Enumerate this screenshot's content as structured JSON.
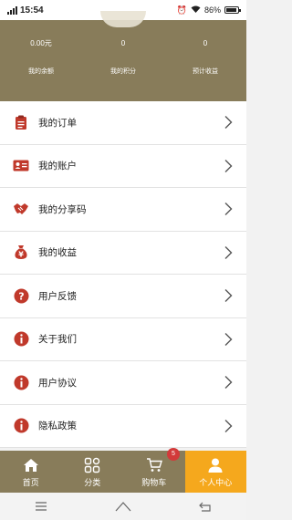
{
  "status_bar": {
    "time": "15:54",
    "battery": "86%"
  },
  "header": {
    "stats": [
      {
        "value": "0.00元",
        "label": "我的余额"
      },
      {
        "value": "0",
        "label": "我的积分"
      },
      {
        "value": "0",
        "label": "预计收益"
      }
    ]
  },
  "menu": [
    {
      "label": "我的订单",
      "icon": "clipboard-icon"
    },
    {
      "label": "我的账户",
      "icon": "id-card-icon"
    },
    {
      "label": "我的分享码",
      "icon": "handshake-icon"
    },
    {
      "label": "我的收益",
      "icon": "money-bag-icon"
    },
    {
      "label": "用户反馈",
      "icon": "question-icon"
    },
    {
      "label": "关于我们",
      "icon": "info-icon"
    },
    {
      "label": "用户协议",
      "icon": "info-icon"
    },
    {
      "label": "隐私政策",
      "icon": "info-icon"
    }
  ],
  "tabbar": {
    "tabs": [
      {
        "label": "首页",
        "icon": "home-icon"
      },
      {
        "label": "分类",
        "icon": "category-icon"
      },
      {
        "label": "购物车",
        "icon": "cart-icon",
        "badge": "5"
      },
      {
        "label": "个人中心",
        "icon": "user-icon",
        "active": true
      }
    ]
  },
  "colors": {
    "header": "#887c5a",
    "accent": "#f5a81d",
    "icon_red": "#c0392b",
    "badge": "#d23a3a"
  }
}
